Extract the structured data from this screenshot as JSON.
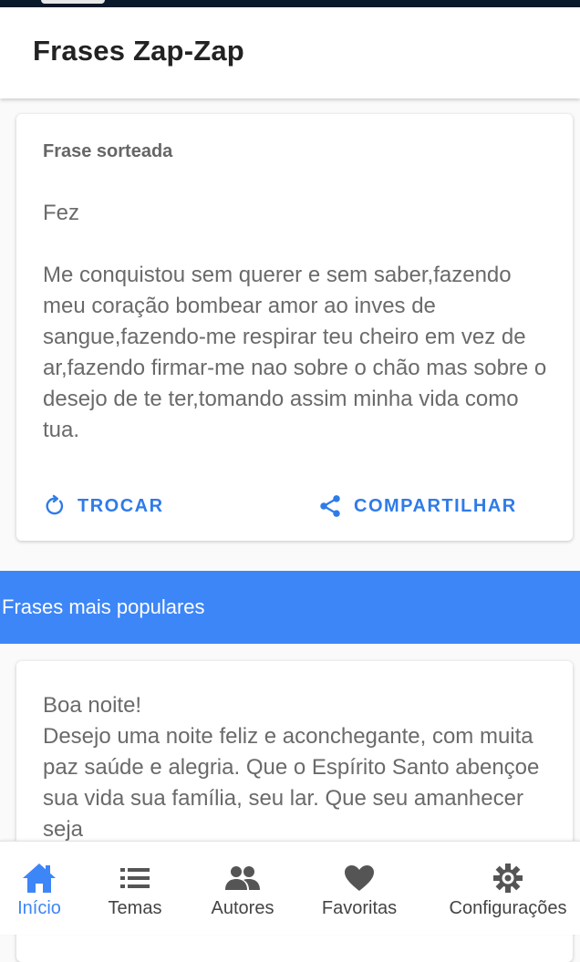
{
  "app": {
    "title": "Frases Zap-Zap"
  },
  "random_card": {
    "label": "Frase sorteada",
    "author": "Fez",
    "phrase": "Me conquistou sem querer e sem saber,fazendo meu coração bombear amor ao inves de sangue,fazendo-me respirar teu cheiro em vez de ar,fazendo firmar-me nao sobre o chão mas sobre o desejo de te ter,tomando assim minha vida como tua.",
    "actions": {
      "swap_label": "TROCAR",
      "share_label": "COMPARTILHAR"
    }
  },
  "popular": {
    "header": "Frases mais populares",
    "first_phrase": "Boa noite!\nDesejo uma noite feliz e aconchegante, com muita paz saúde e alegria. Que o Espírito Santo abençoe sua vida sua família, seu lar. Que seu amanhecer seja"
  },
  "bottom_nav": {
    "items": [
      {
        "label": "Início",
        "icon": "home-icon",
        "active": true
      },
      {
        "label": "Temas",
        "icon": "list-icon",
        "active": false
      },
      {
        "label": "Autores",
        "icon": "people-icon",
        "active": false
      },
      {
        "label": "Favoritas",
        "icon": "heart-icon",
        "active": false
      },
      {
        "label": "Configurações",
        "icon": "gear-icon",
        "active": false
      }
    ]
  },
  "colors": {
    "accent": "#3d86f7",
    "action_text": "#2f7be8",
    "nav_icon": "#555555"
  }
}
